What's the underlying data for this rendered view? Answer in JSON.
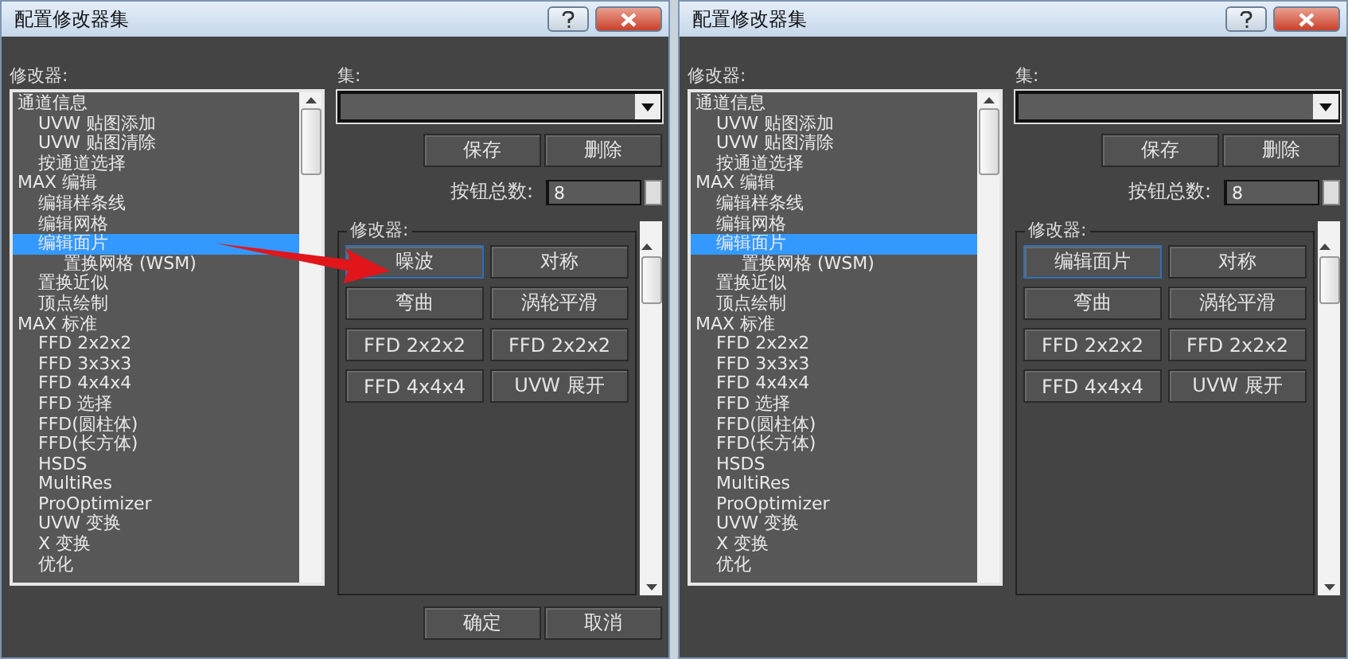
{
  "dialogs": [
    {
      "title": "配置修改器集",
      "arrow": true,
      "list_label": "修改器:",
      "modifiers": [
        {
          "label": "通道信息",
          "selected": false,
          "children": [
            {
              "label": "UVW 贴图添加",
              "selected": false
            },
            {
              "label": "UVW 贴图清除",
              "selected": false
            },
            {
              "label": "按通道选择",
              "selected": false
            }
          ]
        },
        {
          "label": "MAX 编辑",
          "selected": false,
          "children": [
            {
              "label": "编辑样条线",
              "selected": false
            },
            {
              "label": "编辑网格",
              "selected": false
            },
            {
              "label": "编辑面片",
              "selected": true,
              "children": [
                {
                  "label": "置换网格 (WSM)",
                  "selected": false
                }
              ]
            },
            {
              "label": "置换近似",
              "selected": false
            },
            {
              "label": "顶点绘制",
              "selected": false
            }
          ]
        },
        {
          "label": "MAX 标准",
          "selected": false,
          "children": [
            {
              "label": "FFD 2x2x2",
              "selected": false
            },
            {
              "label": "FFD 3x3x3",
              "selected": false
            },
            {
              "label": "FFD 4x4x4",
              "selected": false
            },
            {
              "label": "FFD 选择",
              "selected": false
            },
            {
              "label": "FFD(圆柱体)",
              "selected": false
            },
            {
              "label": "FFD(长方体)",
              "selected": false
            },
            {
              "label": "HSDS",
              "selected": false
            },
            {
              "label": "MultiRes",
              "selected": false
            },
            {
              "label": "ProOptimizer",
              "selected": false
            },
            {
              "label": "UVW 变换",
              "selected": false
            },
            {
              "label": "X 变换",
              "selected": false
            },
            {
              "label": "优化",
              "selected": false
            }
          ]
        }
      ],
      "set_label": "集:",
      "set_buttons": [
        "保存",
        "删除"
      ],
      "count_label": "按钮总数:",
      "count_value": "8",
      "group_label": "修改器:",
      "grid_buttons": [
        {
          "label": "噪波",
          "focused": true
        },
        {
          "label": "对称",
          "focused": false
        },
        {
          "label": "弯曲",
          "focused": false
        },
        {
          "label": "涡轮平滑",
          "focused": false
        },
        {
          "label": "FFD 2x2x2",
          "focused": false
        },
        {
          "label": "FFD 2x2x2",
          "focused": false
        },
        {
          "label": "FFD 4x4x4",
          "focused": false
        },
        {
          "label": "UVW 展开",
          "focused": false
        }
      ],
      "footer_buttons": [
        "确定",
        "取消"
      ]
    },
    {
      "title": "配置修改器集",
      "arrow": false,
      "list_label": "修改器:",
      "modifiers": [
        {
          "label": "通道信息",
          "selected": false,
          "children": [
            {
              "label": "UVW 贴图添加",
              "selected": false
            },
            {
              "label": "UVW 贴图清除",
              "selected": false
            },
            {
              "label": "按通道选择",
              "selected": false
            }
          ]
        },
        {
          "label": "MAX 编辑",
          "selected": false,
          "children": [
            {
              "label": "编辑样条线",
              "selected": false
            },
            {
              "label": "编辑网格",
              "selected": false
            },
            {
              "label": "编辑面片",
              "selected": true,
              "children": [
                {
                  "label": "置换网格 (WSM)",
                  "selected": false
                }
              ]
            },
            {
              "label": "置换近似",
              "selected": false
            },
            {
              "label": "顶点绘制",
              "selected": false
            }
          ]
        },
        {
          "label": "MAX 标准",
          "selected": false,
          "children": [
            {
              "label": "FFD 2x2x2",
              "selected": false
            },
            {
              "label": "FFD 3x3x3",
              "selected": false
            },
            {
              "label": "FFD 4x4x4",
              "selected": false
            },
            {
              "label": "FFD 选择",
              "selected": false
            },
            {
              "label": "FFD(圆柱体)",
              "selected": false
            },
            {
              "label": "FFD(长方体)",
              "selected": false
            },
            {
              "label": "HSDS",
              "selected": false
            },
            {
              "label": "MultiRes",
              "selected": false
            },
            {
              "label": "ProOptimizer",
              "selected": false
            },
            {
              "label": "UVW 变换",
              "selected": false
            },
            {
              "label": "X 变换",
              "selected": false
            },
            {
              "label": "优化",
              "selected": false
            }
          ]
        }
      ],
      "set_label": "集:",
      "set_buttons": [
        "保存",
        "删除"
      ],
      "count_label": "按钮总数:",
      "count_value": "8",
      "group_label": "修改器:",
      "grid_buttons": [
        {
          "label": "编辑面片",
          "focused": true
        },
        {
          "label": "对称",
          "focused": false
        },
        {
          "label": "弯曲",
          "focused": false
        },
        {
          "label": "涡轮平滑",
          "focused": false
        },
        {
          "label": "FFD 2x2x2",
          "focused": false
        },
        {
          "label": "FFD 2x2x2",
          "focused": false
        },
        {
          "label": "FFD 4x4x4",
          "focused": false
        },
        {
          "label": "UVW 展开",
          "focused": false
        }
      ]
    }
  ]
}
